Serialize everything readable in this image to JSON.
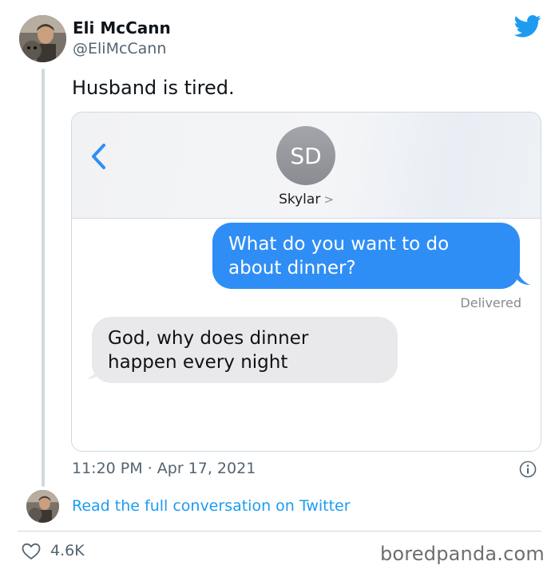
{
  "tweet": {
    "author_name": "Eli McCann",
    "author_handle": "@EliMcCann",
    "text": "Husband is tired.",
    "timestamp": "11:20 PM · Apr 17, 2021",
    "read_link": "Read the full conversation on Twitter",
    "like_count": "4.6K",
    "brand_color": "#1d9bf0"
  },
  "message_screenshot": {
    "contact_initials": "SD",
    "contact_name": "Skylar",
    "contact_chevron": ">",
    "outgoing_text": "What do you want to do about dinner?",
    "status": "Delivered",
    "incoming_text": "God, why does dinner happen every night",
    "outgoing_color": "#2f8ef5",
    "incoming_color": "#e9e9eb"
  },
  "watermark": "boredpanda.com",
  "icons": [
    "twitter-bird-icon",
    "back-chevron-icon",
    "info-icon",
    "heart-icon"
  ]
}
